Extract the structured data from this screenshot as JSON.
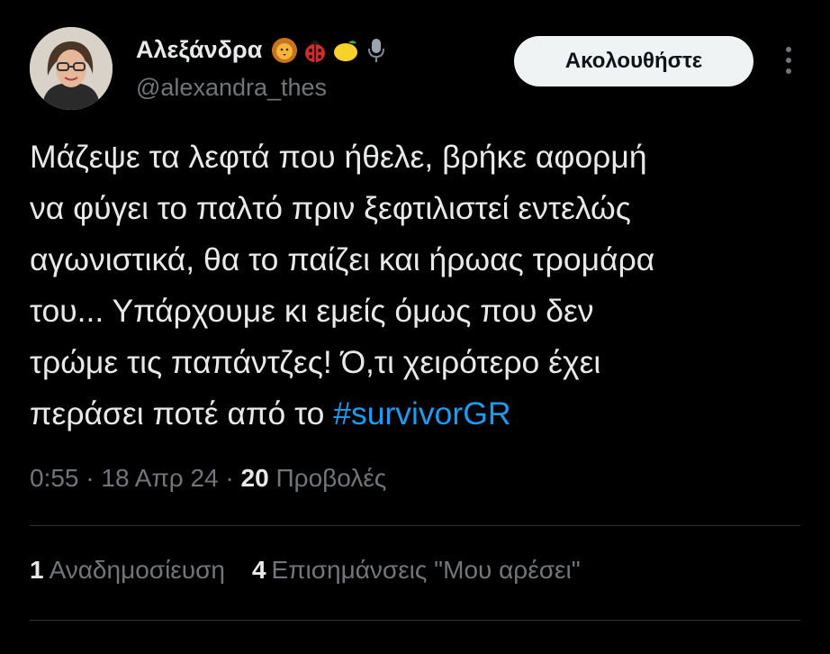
{
  "author": {
    "display_name": "Αλεξάνδρα",
    "handle": "@alexandra_thes",
    "badges": [
      "lion-emoji",
      "ladybug-emoji",
      "lemon-emoji",
      "microphone-emoji"
    ]
  },
  "follow_button": {
    "label": "Ακολουθήστε"
  },
  "tweet": {
    "lines": [
      "Μάζεψε τα λεφτά που ήθελε, βρήκε αφορμή",
      "να φύγει το παλτό πριν ξεφτιλιστεί εντελώς",
      "αγωνιστικά, θα το παίζει και ήρωας τρομάρα",
      "του... Υπάρχουμε κι εμείς όμως που δεν",
      "τρώμε τις παπάντζες! Ό,τι χειρότερο έχει",
      "περάσει ποτέ από το "
    ],
    "hashtag": "#survivorGR"
  },
  "meta": {
    "time": "0:55",
    "sep1": " · ",
    "date": "18 Απρ 24",
    "sep2": " · ",
    "views_count": "20",
    "views_label": " Προβολές"
  },
  "stats": {
    "reposts_count": "1",
    "reposts_label": "Αναδημοσίευση",
    "likes_count": "4",
    "likes_label": "Επισημάνσεις \"Μου αρέσει\""
  },
  "colors": {
    "background": "#000000",
    "text": "#e7e9ea",
    "muted": "#71767b",
    "link": "#1d9bf0"
  }
}
